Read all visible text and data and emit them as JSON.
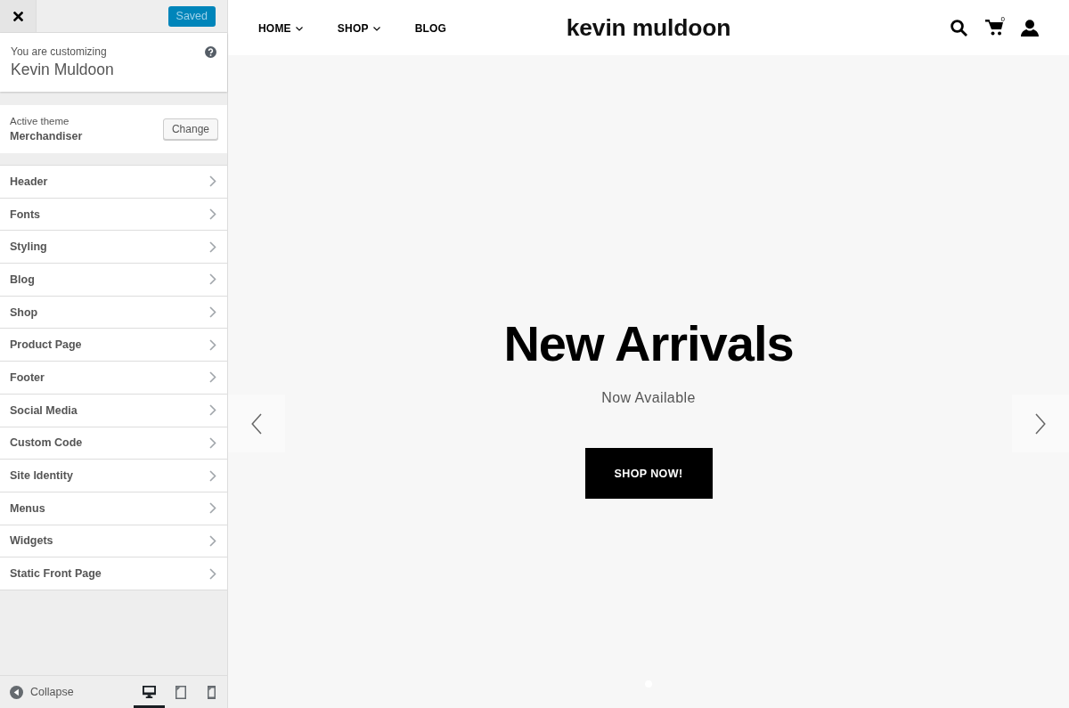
{
  "customizer": {
    "save_button": {
      "label": "Saved",
      "disabled": true
    },
    "info": {
      "caption": "You are customizing",
      "site_name": "Kevin Muldoon"
    },
    "theme": {
      "caption": "Active theme",
      "name": "Merchandiser",
      "button": "Change"
    },
    "sections": [
      {
        "label": "Header"
      },
      {
        "label": "Fonts"
      },
      {
        "label": "Styling"
      },
      {
        "label": "Blog"
      },
      {
        "label": "Shop"
      },
      {
        "label": "Product Page"
      },
      {
        "label": "Footer"
      },
      {
        "label": "Social Media"
      },
      {
        "label": "Custom Code"
      },
      {
        "label": "Site Identity"
      },
      {
        "label": "Menus"
      },
      {
        "label": "Widgets"
      },
      {
        "label": "Static Front Page"
      }
    ],
    "footer": {
      "collapse": "Collapse",
      "devices": [
        {
          "kind": "desktop",
          "selected": true
        },
        {
          "kind": "tablet",
          "selected": false
        },
        {
          "kind": "mobile",
          "selected": false
        }
      ]
    }
  },
  "preview": {
    "nav": [
      {
        "label": "HOME",
        "dropdown": true
      },
      {
        "label": "SHOP",
        "dropdown": true
      },
      {
        "label": "BLOG",
        "dropdown": false
      }
    ],
    "logo": "kevin muldoon",
    "cart_count": "0",
    "hero": {
      "title": "New Arrivals",
      "subtitle": "Now Available",
      "button": "SHOP NOW!",
      "slides": [
        {
          "selected": true
        }
      ]
    }
  }
}
